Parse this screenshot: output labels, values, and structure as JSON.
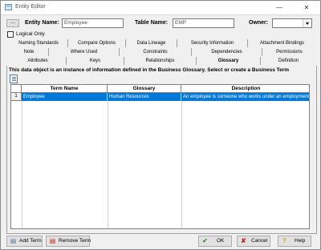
{
  "window": {
    "title": "Entity Editor"
  },
  "header": {
    "ellipsis_label": "...",
    "entity_name_label": "Entity Name:",
    "entity_name_value": "Employee",
    "table_name_label": "Table Name:",
    "table_name_value": "EMP",
    "owner_label": "Owner:",
    "owner_value": "",
    "logical_only_label": "Logical Only",
    "logical_only_checked": false
  },
  "tabs": {
    "row1": [
      "Naming Standards",
      "Compare Options",
      "Data Lineage",
      "Security Information",
      "Attachment Bindings"
    ],
    "row2": [
      "Note",
      "Where Used",
      "Constraints",
      "Dependencies",
      "Permissions"
    ],
    "row3": [
      "Attributes",
      "Keys",
      "Relationships",
      "Glossary",
      "Definition"
    ],
    "active": "Glossary"
  },
  "glossary": {
    "description": "This data object is an instance of information defined in the Business Glossary. Select or create a Business Term",
    "columns": [
      "Term Name",
      "Glossary",
      "Description"
    ],
    "rows": [
      {
        "num": "1",
        "term": "Employee",
        "glossary": "Human Resources",
        "description": "An employee is someone who works under an employment cont"
      }
    ]
  },
  "buttons": {
    "add_term": "Add Term",
    "remove_term": "Remove Term",
    "ok": "OK",
    "cancel": "Cancel",
    "help": "Help"
  },
  "colors": {
    "selection": "#0078d7",
    "ok_check": "#2e9e2e",
    "cancel_x": "#c42b1c"
  }
}
